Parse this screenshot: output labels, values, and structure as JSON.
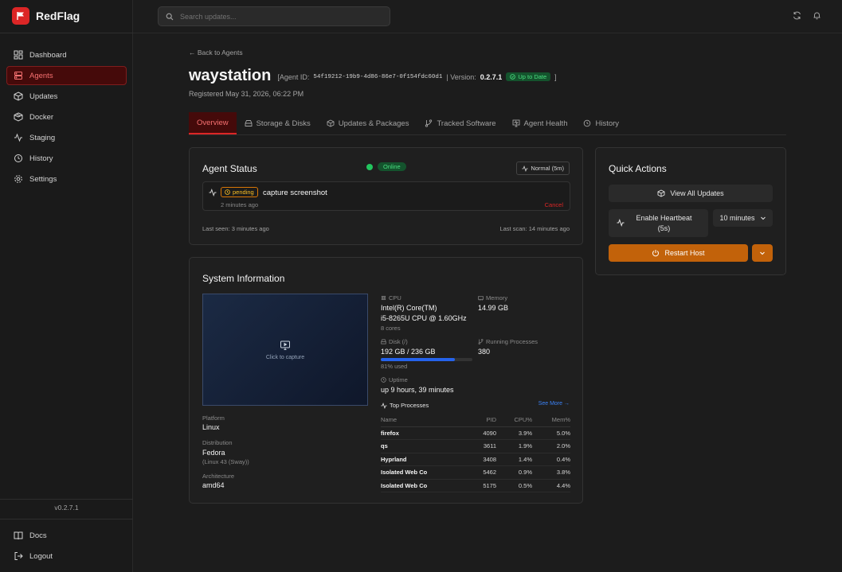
{
  "brand": {
    "name": "RedFlag"
  },
  "sidebar": {
    "items": [
      {
        "label": "Dashboard",
        "icon": "dashboard-icon"
      },
      {
        "label": "Agents",
        "icon": "agents-icon",
        "active": true
      },
      {
        "label": "Updates",
        "icon": "package-icon"
      },
      {
        "label": "Docker",
        "icon": "docker-icon"
      },
      {
        "label": "Staging",
        "icon": "activity-icon"
      },
      {
        "label": "History",
        "icon": "history-icon"
      },
      {
        "label": "Settings",
        "icon": "gear-icon"
      }
    ],
    "version": "v0.2.7.1",
    "bottom": [
      {
        "label": "Docs",
        "icon": "book-icon"
      },
      {
        "label": "Logout",
        "icon": "logout-icon"
      }
    ]
  },
  "search": {
    "placeholder": "Search updates..."
  },
  "agent": {
    "back_label": "← Back to Agents",
    "name": "waystation",
    "id_prefix": "[Agent ID:",
    "id": "54f19212-19b9-4d86-86e7-0f154fdc60d1",
    "version_label": "| Version:",
    "version": "0.2.7.1",
    "status_badge": "Up to Date",
    "bracket_close": "]",
    "registered": "Registered May 31, 2026, 06:22 PM"
  },
  "tabs": [
    {
      "label": "Overview",
      "icon": ""
    },
    {
      "label": "Storage & Disks",
      "icon": "storage-icon"
    },
    {
      "label": "Updates & Packages",
      "icon": "package-icon"
    },
    {
      "label": "Tracked Software",
      "icon": "branch-icon"
    },
    {
      "label": "Agent Health",
      "icon": "health-icon"
    },
    {
      "label": "History",
      "icon": "history-icon"
    }
  ],
  "status_card": {
    "title": "Agent Status",
    "online": "Online",
    "heartbeat": "Normal (5m)",
    "command": {
      "state": "pending",
      "text": "capture screenshot",
      "time": "2 minutes ago",
      "cancel": "Cancel"
    },
    "last_seen": "Last seen: 3 minutes ago",
    "last_scan": "Last scan: 14 minutes ago"
  },
  "quick_actions": {
    "title": "Quick Actions",
    "view_updates": "View All Updates",
    "heartbeat_line1": "Enable Heartbeat",
    "heartbeat_line2": "(5s)",
    "duration": "10 minutes",
    "restart": "Restart Host"
  },
  "system": {
    "title": "System Information",
    "capture_label": "Click to capture",
    "platform_label": "Platform",
    "platform": "Linux",
    "distribution_label": "Distribution",
    "distribution": "Fedora",
    "distribution_sub": "(Linux 43 (Sway))",
    "architecture_label": "Architecture",
    "architecture": "amd64",
    "cpu_label": "CPU",
    "cpu_line1": "Intel(R) Core(TM)",
    "cpu_line2": "i5-8265U CPU @ 1.60GHz",
    "cpu_cores": "8 cores",
    "memory_label": "Memory",
    "memory": "14.99 GB",
    "disk_label": "Disk (/)",
    "disk": "192 GB / 236 GB",
    "disk_used": "81% used",
    "disk_fraction": 0.81,
    "processes_label": "Running Processes",
    "processes": "380",
    "uptime_label": "Uptime",
    "uptime": "up 9 hours, 39 minutes",
    "top_label": "Top Processes",
    "see_more": "See More →",
    "columns": [
      "Name",
      "PID",
      "CPU%",
      "Mem%"
    ],
    "rows": [
      [
        "firefox",
        "4090",
        "3.9%",
        "5.0%"
      ],
      [
        "qs",
        "3611",
        "1.9%",
        "2.0%"
      ],
      [
        "Hyprland",
        "3408",
        "1.4%",
        "0.4%"
      ],
      [
        "Isolated Web Co",
        "5462",
        "0.9%",
        "3.8%"
      ],
      [
        "Isolated Web Co",
        "5175",
        "0.5%",
        "4.4%"
      ]
    ]
  }
}
